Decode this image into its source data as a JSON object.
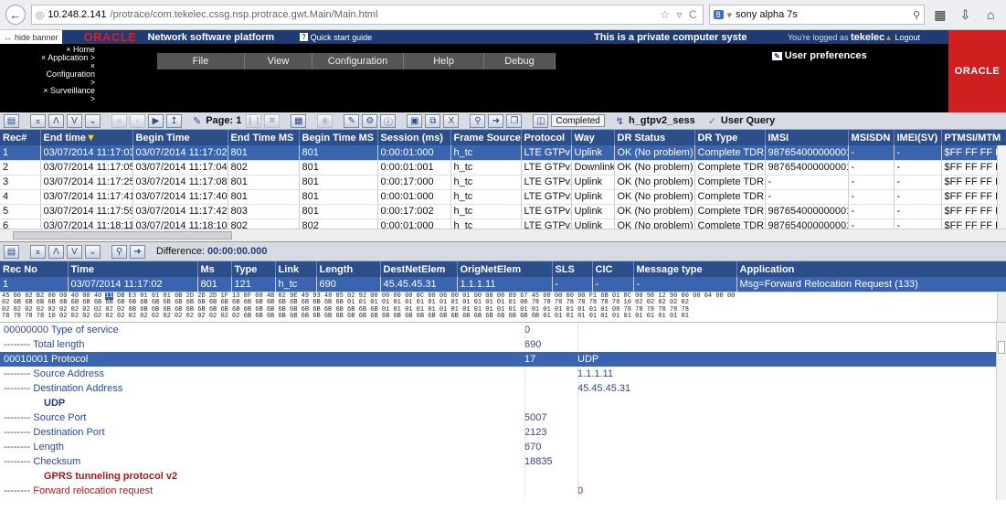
{
  "browser": {
    "url_host": "10.248.2.141",
    "url_path": "/protrace/com.tekelec.cssg.nsp.protrace.gwt.Main/Main.html",
    "search_engine_badge": "8",
    "search_text": "sony alpha 7s"
  },
  "header": {
    "hide_banner": "hide banner",
    "brand": "ORACLE",
    "product": "Network software platform",
    "quick_start": "Quick start guide",
    "private_notice": "This is a private computer syste",
    "logged_prefix": "You're logged as",
    "user": "tekelec",
    "logout": "Logout",
    "user_preferences": "User preferences",
    "logo": "ORACLE",
    "nav_tree": [
      "× Home",
      "× Application >",
      "× Configuration >",
      "× Surveillance >"
    ],
    "menu": [
      "File",
      "View",
      "Configuration",
      "Help",
      "Debug"
    ]
  },
  "toolbar1": {
    "page_label": "Page: 1",
    "status": "Completed",
    "session": "h_gtpv2_sess",
    "user_query": "User Query"
  },
  "records": {
    "columns": [
      "Rec#",
      "End time",
      "Begin Time",
      "End Time MS",
      "Begin Time MS",
      "Session (ms)",
      "Frame Source",
      "Protocol",
      "Way",
      "DR Status",
      "DR Type",
      "IMSI",
      "MSISDN",
      "IMEI(SV)",
      "PTMSI/MTM"
    ],
    "rows": [
      [
        "1",
        "03/07/2014 11:17:03",
        "03/07/2014 11:17:02",
        "801",
        "801",
        "0:00:01:000",
        "h_tc",
        "LTE GTPv2",
        "Uplink",
        "OK (No problem)",
        "Complete TDR",
        "987654000000001",
        "-",
        "-",
        "$FF FF FF F"
      ],
      [
        "2",
        "03/07/2014 11:17:05",
        "03/07/2014 11:17:04",
        "802",
        "801",
        "0:00:01:001",
        "h_tc",
        "LTE GTPv2",
        "Downlink",
        "OK (No problem)",
        "Complete TDR",
        "987654000000001",
        "-",
        "-",
        "$FF FF FF F"
      ],
      [
        "3",
        "03/07/2014 11:17:25",
        "03/07/2014 11:17:08",
        "801",
        "801",
        "0:00:17:000",
        "h_tc",
        "LTE GTPv2",
        "Uplink",
        "OK (No problem)",
        "Complete TDR",
        "-",
        "-",
        "-",
        "$FF FF FF F"
      ],
      [
        "4",
        "03/07/2014 11:17:41",
        "03/07/2014 11:17:40",
        "801",
        "801",
        "0:00:01:000",
        "h_tc",
        "LTE GTPv2",
        "Uplink",
        "OK (No problem)",
        "Complete TDR",
        "-",
        "-",
        "-",
        "$FF FF FF F"
      ],
      [
        "5",
        "03/07/2014 11:17:59",
        "03/07/2014 11:17:42",
        "803",
        "801",
        "0:00:17:002",
        "h_tc",
        "LTE GTPv2",
        "Uplink",
        "OK (No problem)",
        "Complete TDR",
        "987654000000001",
        "-",
        "-",
        "$FF FF FF F"
      ],
      [
        "6",
        "03/07/2014 11:18:11",
        "03/07/2014 11:18:10",
        "802",
        "802",
        "0:00:01:000",
        "h_tc",
        "LTE GTPv2",
        "Uplink",
        "OK (No problem)",
        "Complete TDR",
        "987654000000001",
        "-",
        "-",
        "$FF FF FF F"
      ]
    ]
  },
  "toolbar2": {
    "difference_label": "Difference:",
    "difference_value": "00:00:00.000"
  },
  "messages": {
    "columns": [
      "Rec No",
      "Time",
      "Ms",
      "Type",
      "Link",
      "Length",
      "DestNetElem",
      "OrigNetElem",
      "SLS",
      "CIC",
      "Message type",
      "Application"
    ],
    "rows": [
      [
        "1",
        "03/07/2014 11:17:02",
        "801",
        "121",
        "h_tc",
        "690",
        "45.45.45.31",
        "1.1.1.11",
        "-",
        "-",
        "-",
        "Msg=Forward Relocation Request (133)"
      ]
    ]
  },
  "hex": {
    "line1_pre": "45 00 02 B2 00 00 40 00 40 ",
    "line1_hl": "11",
    "line1_post": " DB E3 01 01 01 0B 2D 2D 2D 1F 13 8F 08 4B 02 9E 49 93 48 85 02 92 00 00 00 00 0C 00 06 00 01 00 08 00 89 67 45 00 00 00 00 F1 6B 01 8C 00 98 12 90 00 00 04 00 00",
    "line2": "02 6B 6B 6B 6B 6B 6B 6B 6B 6B 6B 6B 6B 6B 6B 6B 6B 6B 6B 6B 6B 6B 6B 6B 6B 6B 6B 6B 6B 6B 01 01 01 01 01 01 01 01 01 01 01 01 01 01 01 08 78 78 78 78 78 78 78 78 10 02 02 02 02 02",
    "line3": "02 02 02 02 02 02 02 02 02 02 02 6B 6B 6B 6B 6B 6B 6B 6B 6B 6B 6B 6B 6B 6B 6B 6B 6B 6B 6B 6B 6B 6B 01 01 01 01 01 01 01 01 01 01 01 01 01 01 01 01 01 01 01 01 08 78 78 78 78 78 78",
    "line4": "78 78 78 78 10 02 02 02 02 02 02 02 02 02 02 02 02 02 02 02 02 6B 6B 6B 6B 6B 6B 6B 6B 6B 6B 6B 6B 6B 6B 6B 6B 6B 6B 6B 6B 6B 6B 6B 6B 6B 6B 01 01 01 01 01 01 01 01 01 01 01 01 01"
  },
  "decode": [
    {
      "prefix": "00000000",
      "label": "Type of service",
      "v1": "0",
      "v2": "",
      "kind": "normal"
    },
    {
      "prefix": "--------",
      "label": "Total length",
      "v1": "690",
      "v2": "",
      "kind": "normal"
    },
    {
      "prefix": "00010001",
      "label": "Protocol",
      "v1": "17",
      "v2": "UDP",
      "kind": "sel"
    },
    {
      "prefix": "--------",
      "label": "Source Address",
      "v1": "",
      "v2": "1.1.1.11",
      "kind": "normal"
    },
    {
      "prefix": "--------",
      "label": "Destination Address",
      "v1": "",
      "v2": "45.45.45.31",
      "kind": "normal"
    },
    {
      "prefix": "",
      "label": "UDP",
      "v1": "",
      "v2": "",
      "kind": "hdr"
    },
    {
      "prefix": "--------",
      "label": "Source Port",
      "v1": "5007",
      "v2": "",
      "kind": "normal"
    },
    {
      "prefix": "--------",
      "label": "Destination Port",
      "v1": "2123",
      "v2": "",
      "kind": "normal"
    },
    {
      "prefix": "--------",
      "label": "Length",
      "v1": "670",
      "v2": "",
      "kind": "normal"
    },
    {
      "prefix": "--------",
      "label": "Checksum",
      "v1": "18835",
      "v2": "",
      "kind": "normal"
    },
    {
      "prefix": "",
      "label": "GPRS tunneling protocol v2",
      "v1": "",
      "v2": "",
      "kind": "red"
    },
    {
      "prefix": "--------",
      "label": "Forward relocation request",
      "v1": "",
      "v2": "0",
      "kind": "redsub"
    }
  ]
}
